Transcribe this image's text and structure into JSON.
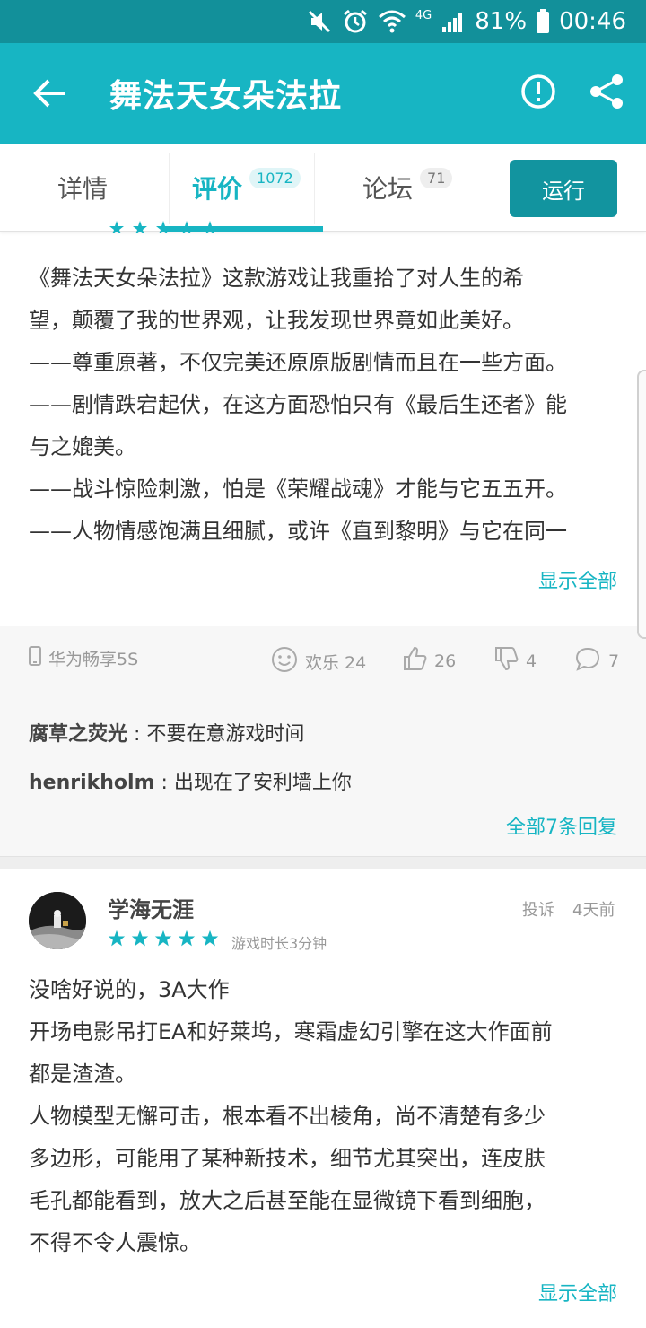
{
  "status_bar": {
    "battery": "81%",
    "time": "00:46",
    "network": "4G"
  },
  "app_bar": {
    "title": "舞法天女朵法拉"
  },
  "tabs": [
    {
      "label": "详情",
      "badge": ""
    },
    {
      "label": "评价",
      "badge": "1072"
    },
    {
      "label": "论坛",
      "badge": "71"
    }
  ],
  "run_button": "运行",
  "review1": {
    "lines": [
      "《舞法天女朵法拉》这款游戏让我重拾了对人生的希",
      "望，颠覆了我的世界观，让我发现世界竟如此美好。",
      "——尊重原著，不仅完美还原原版剧情而且在一些方面。",
      "——剧情跌宕起伏，在这方面恐怕只有《最后生还者》能",
      "与之媲美。",
      "——战斗惊险刺激，怕是《荣耀战魂》才能与它五五开。",
      "——人物情感饱满且细腻，或许《直到黎明》与它在同一"
    ],
    "show_all": "显示全部",
    "device": "华为畅享5S",
    "fun_label": "欢乐 24",
    "likes": "26",
    "dislikes": "4",
    "comments": "7",
    "replies": [
      {
        "name": "腐草之荧光",
        "text": " : 不要在意游戏时间"
      },
      {
        "name": "henrikholm",
        "text": " : 出现在了安利墙上你"
      }
    ],
    "all_replies": "全部7条回复"
  },
  "review2": {
    "username": "学海无涯",
    "complain": "投诉",
    "time": "4天前",
    "rating": 5,
    "playtime": "游戏时长3分钟",
    "lines": [
      "没啥好说的，3A大作",
      "开场电影吊打EA和好莱坞，寒霜虚幻引擎在这大作面前",
      "都是渣渣。",
      "人物模型无懈可击，根本看不出棱角，尚不清楚有多少",
      "多边形，可能用了某种新技术，细节尤其突出，连皮肤",
      "毛孔都能看到，放大之后甚至能在显微镜下看到细胞，",
      "不得不令人震惊。"
    ],
    "show_all": "显示全部"
  },
  "colors": {
    "primary": "#17b5c3",
    "status_bar": "#12909a",
    "star": "#17b5c3"
  }
}
